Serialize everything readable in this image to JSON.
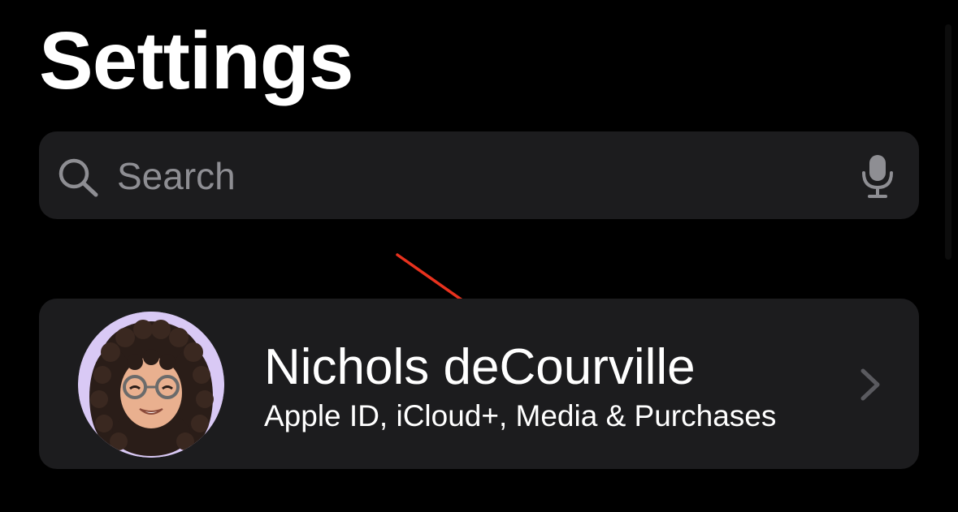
{
  "header": {
    "title": "Settings"
  },
  "search": {
    "placeholder": "Search",
    "icon": "search-icon",
    "mic_icon": "microphone-icon"
  },
  "profile": {
    "name": "Nichols deCourville",
    "subtitle": "Apple ID, iCloud+, Media & Purchases",
    "avatar": "memoji-avatar",
    "chevron": "chevron-right-icon"
  },
  "colors": {
    "background": "#000000",
    "card": "#1c1c1e",
    "secondary_text": "#8e8e93",
    "annotation_arrow": "#e8321e",
    "avatar_background": "#d9c9f5"
  }
}
